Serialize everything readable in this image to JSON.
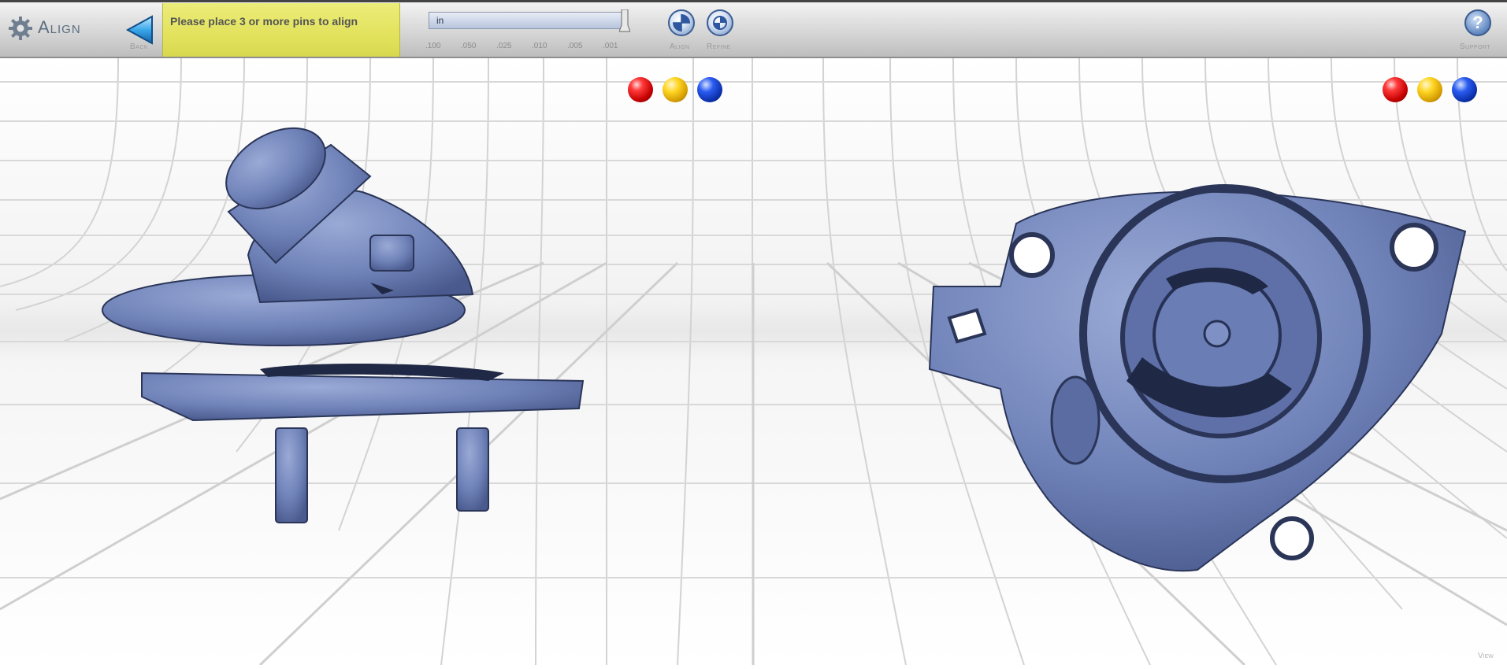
{
  "app": {
    "title": "Align"
  },
  "toolbar": {
    "back_label": "Back",
    "message": "Please place 3 or more pins to align",
    "unit_value": "in",
    "scale_ticks": [
      ".100",
      ".050",
      ".025",
      ".010",
      ".005",
      ".001"
    ],
    "align_label": "Align",
    "refine_label": "Refine",
    "support_label": "Support",
    "support_symbol": "?"
  },
  "left_view": {
    "pins": [
      "red",
      "yellow",
      "blue"
    ],
    "model": "thermostat-housing-side-view"
  },
  "right_view": {
    "pins": [
      "red",
      "yellow",
      "blue"
    ],
    "model": "thermostat-housing-bottom-view"
  },
  "footer": {
    "view_label": "View"
  },
  "colors": {
    "model": "#6f82b8",
    "message_bg": "#e2e25d",
    "pin_red": "#d40000",
    "pin_yellow": "#f2b800",
    "pin_blue": "#0b3ac0"
  }
}
